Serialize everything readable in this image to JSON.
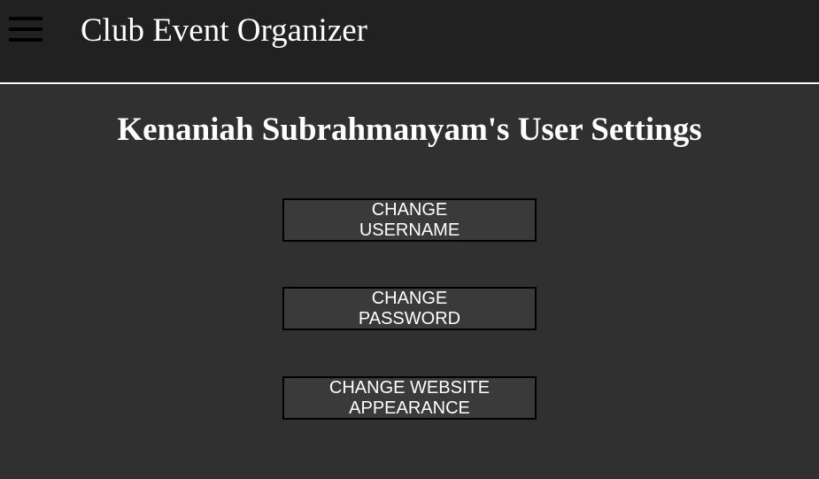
{
  "header": {
    "menu_icon": "hamburger-menu-icon",
    "app_title": "Club Event Organizer"
  },
  "main": {
    "page_title": "Kenaniah Subrahmanyam's User Settings",
    "buttons": {
      "change_username": "CHANGE USERNAME",
      "change_password": "CHANGE PASSWORD",
      "change_appearance": "CHANGE WEBSITE APPEARANCE"
    }
  },
  "colors": {
    "page_background": "#303030",
    "header_background": "#212121",
    "button_background": "#3a3a3a",
    "button_border": "#000000",
    "text": "#ffffff"
  }
}
